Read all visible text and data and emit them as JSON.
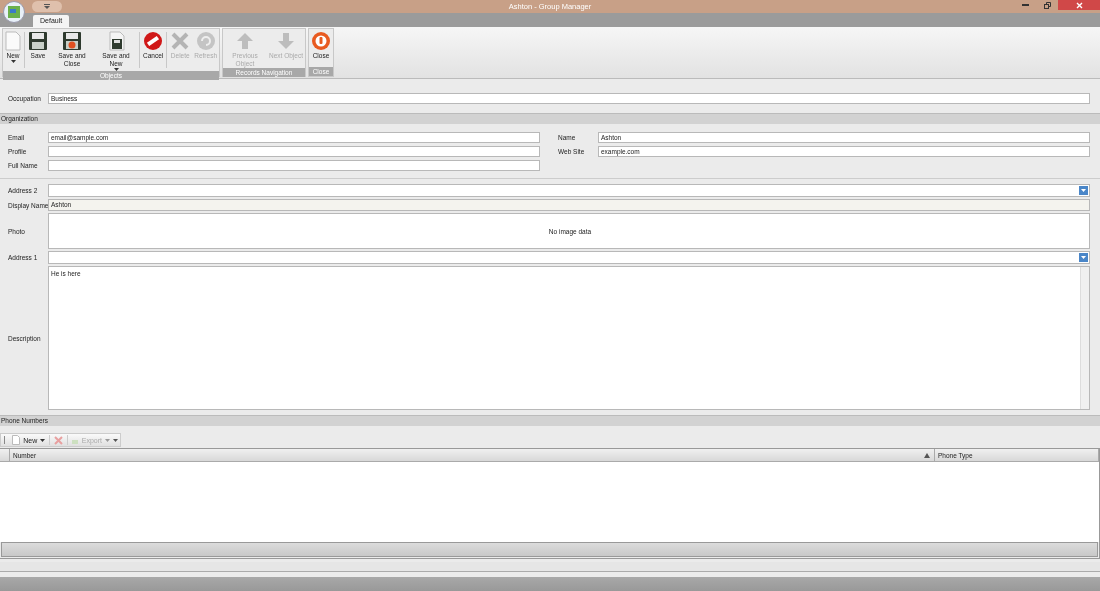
{
  "window": {
    "title": "Ashton - Group Manager"
  },
  "tabs": [
    {
      "label": "Default",
      "selected": true
    }
  ],
  "ribbon": {
    "groups": [
      {
        "label": "Objects",
        "buttons": [
          {
            "label": "New",
            "kind": "new",
            "disabled": false,
            "dropdown": true
          },
          {
            "label": "Save",
            "kind": "save",
            "disabled": false,
            "dropdown": false
          },
          {
            "label": "Save and Close",
            "kind": "save-close",
            "disabled": false,
            "dropdown": false
          },
          {
            "label": "Save and New",
            "kind": "save-new",
            "disabled": false,
            "dropdown": true
          },
          {
            "label": "Cancel",
            "kind": "cancel",
            "disabled": false,
            "dropdown": false
          },
          {
            "label": "Delete",
            "kind": "delete",
            "disabled": true,
            "dropdown": false
          },
          {
            "label": "Refresh",
            "kind": "refresh",
            "disabled": true,
            "dropdown": false
          }
        ]
      },
      {
        "label": "Records Navigation",
        "buttons": [
          {
            "label": "Previous Object",
            "kind": "previous",
            "disabled": true,
            "dropdown": false
          },
          {
            "label": "Next Object",
            "kind": "next",
            "disabled": true,
            "dropdown": false
          }
        ]
      },
      {
        "label": "Close",
        "buttons": [
          {
            "label": "Close",
            "kind": "close",
            "disabled": false,
            "dropdown": false
          }
        ]
      }
    ]
  },
  "occupation": {
    "label": "Occupation",
    "value": "Business"
  },
  "organization": {
    "title": "Organization",
    "left": [
      {
        "label": "Email",
        "value": "email@sample.com"
      },
      {
        "label": "Profile"
      },
      {
        "label": "Full Name"
      }
    ],
    "right": [
      {
        "label": "Name",
        "value": "Ashton"
      },
      {
        "label": "Web Site",
        "value": "example.com"
      }
    ]
  },
  "fields": [
    {
      "label": "Address 2",
      "kind": "dropdown"
    },
    {
      "label": "Display Name",
      "kind": "readonly",
      "value": "Ashton"
    },
    {
      "label": "Photo",
      "kind": "image",
      "value": "No image data"
    },
    {
      "label": "Address 1",
      "kind": "dropdown"
    },
    {
      "label": "Description",
      "kind": "memo",
      "value": "He is here"
    }
  ],
  "phone_numbers": {
    "title": "Phone Numbers",
    "toolbar": [
      {
        "label": "New",
        "kind": "new",
        "disabled": false
      },
      {
        "kind": "delete",
        "disabled": true
      },
      {
        "label": "Export",
        "kind": "export",
        "disabled": true
      }
    ],
    "columns": [
      {
        "label": "Number",
        "sorted": true
      },
      {
        "label": "Phone Type",
        "sorted": false
      }
    ]
  }
}
